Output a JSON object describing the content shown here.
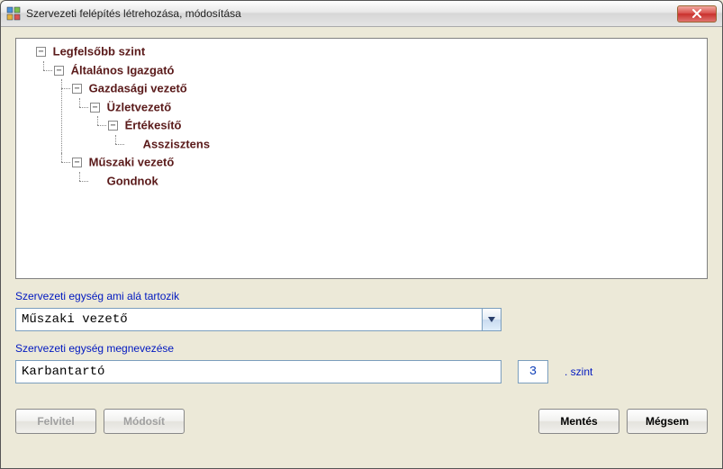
{
  "window": {
    "title": "Szervezeti felépítés létrehozása, módosítása"
  },
  "tree": {
    "root": {
      "label": "Legfelsőbb szint",
      "children": [
        {
          "label": "Általános Igazgató",
          "children": [
            {
              "label": "Gazdasági vezető",
              "children": [
                {
                  "label": "Üzletvezető",
                  "children": [
                    {
                      "label": "Értékesítő",
                      "children": [
                        {
                          "label": "Asszisztens"
                        }
                      ]
                    }
                  ]
                }
              ]
            },
            {
              "label": "Műszaki vezető",
              "children": [
                {
                  "label": "Gondnok"
                }
              ]
            }
          ]
        }
      ]
    }
  },
  "form": {
    "parent_label": "Szervezeti egység ami alá tartozik",
    "parent_value": "Műszaki vezető",
    "name_label": "Szervezeti egység megnevezése",
    "name_value": "Karbantartó",
    "level_value": "3",
    "level_suffix": ". szint"
  },
  "buttons": {
    "felvitel": "Felvitel",
    "modosit": "Módosít",
    "mentes": "Mentés",
    "megsem": "Mégsem"
  },
  "toggle_minus": "−"
}
